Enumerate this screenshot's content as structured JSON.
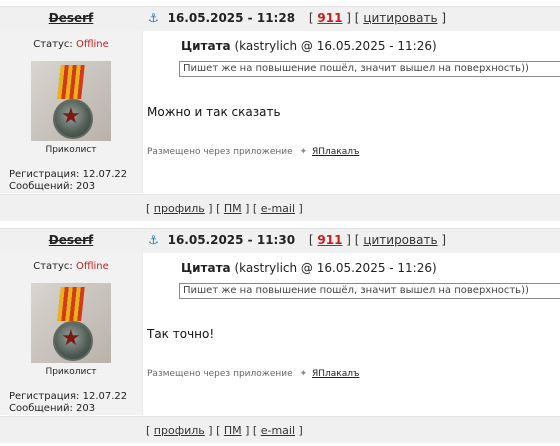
{
  "posts": [
    {
      "author": "Deserf",
      "date": "16.05.2025 - 11:28",
      "post_number": "911",
      "quote_link": "цитировать",
      "status_label": "Статус:",
      "status_value": "Offline",
      "rank": "Приколист",
      "registration": "Регистрация: 12.07.22",
      "messages": "Сообщений: 203",
      "quote_header_label": "Цитата",
      "quote_header_meta": "(kastrylich @ 16.05.2025 - 11:26)",
      "quote_text": "Пишет же на повышение пошёл, значит вышел на поверхность))",
      "message": "Можно и так сказать",
      "posted_via": "Размещено через приложение",
      "app_name": "ЯПлакалъ",
      "footer": {
        "profile": "профиль",
        "pm": "ПМ",
        "email": "e-mail"
      }
    },
    {
      "author": "Deserf",
      "date": "16.05.2025 - 11:30",
      "post_number": "911",
      "quote_link": "цитировать",
      "status_label": "Статус:",
      "status_value": "Offline",
      "rank": "Приколист",
      "registration": "Регистрация: 12.07.22",
      "messages": "Сообщений: 203",
      "quote_header_label": "Цитата",
      "quote_header_meta": "(kastrylich @ 16.05.2025 - 11:26)",
      "quote_text": "Пишет же на повышение пошёл, значит вышел на поверхность))",
      "message": "Так точно!",
      "posted_via": "Размещено через приложение",
      "app_name": "ЯПлакалъ",
      "footer": {
        "profile": "профиль",
        "pm": "ПМ",
        "email": "e-mail"
      }
    }
  ]
}
